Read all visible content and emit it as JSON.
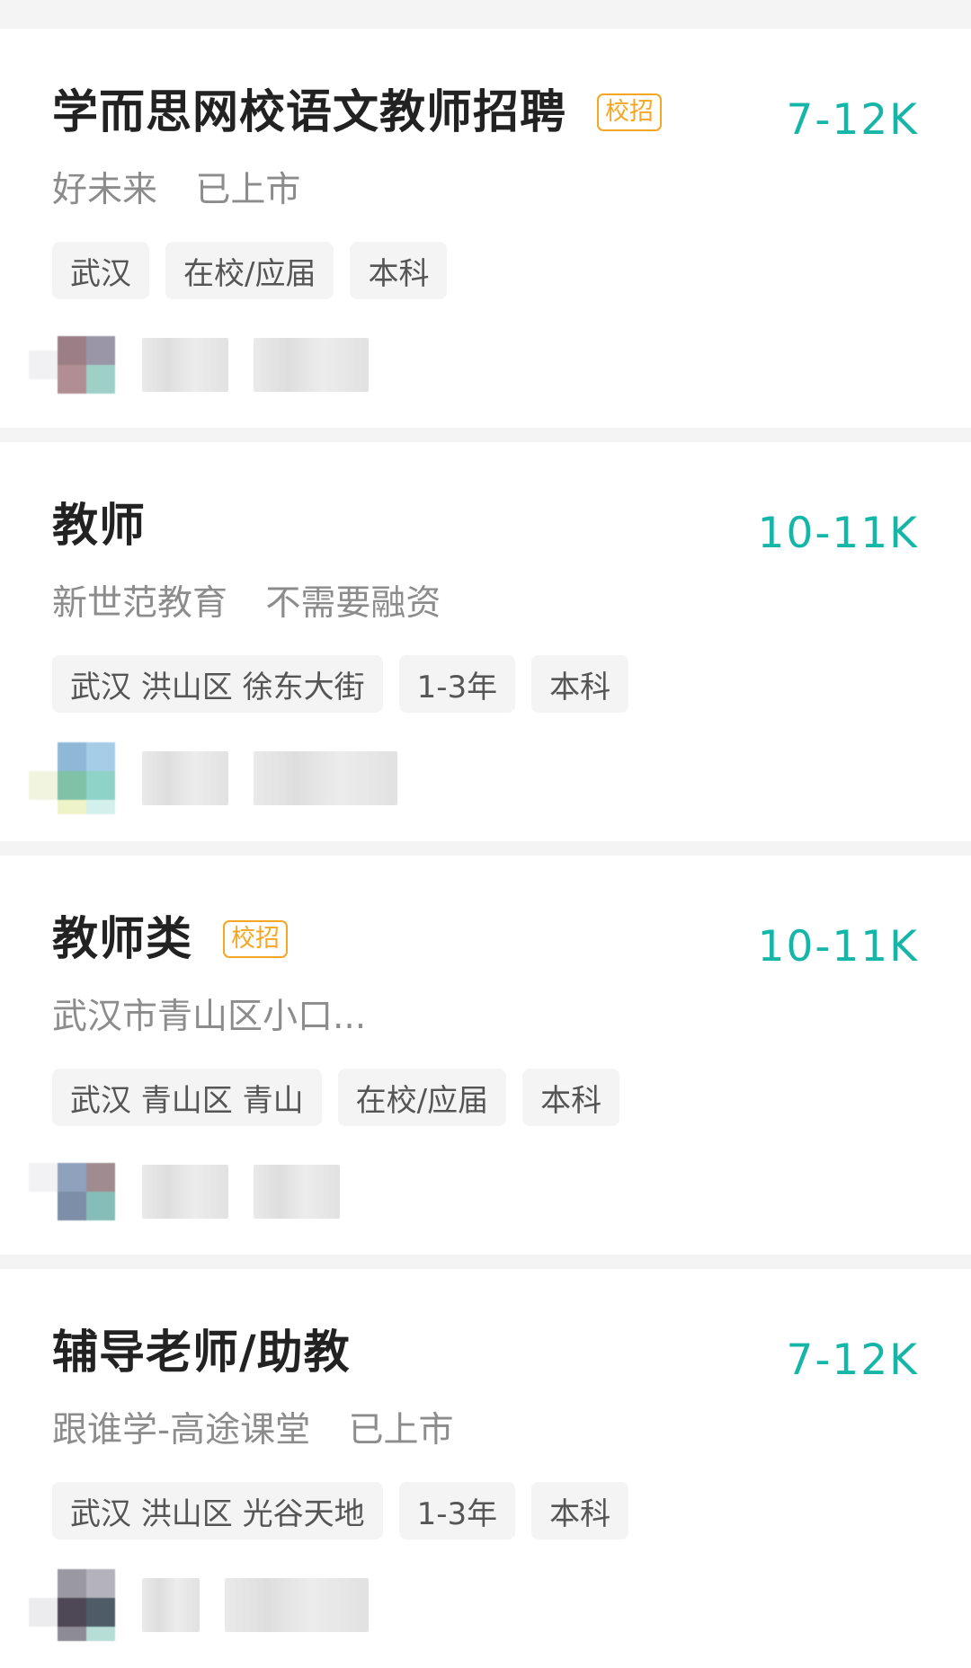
{
  "jobs": [
    {
      "title": "学而思网校语文教师招聘",
      "badge": "校招",
      "salary": "7-12K",
      "company": [
        "好未来",
        "已上市"
      ],
      "tags": [
        "武汉",
        "在校/应届",
        "本科"
      ],
      "avatar_colors": [
        "#9c7f86",
        "#9a96a8",
        "#b08e93",
        "#9fd0c8"
      ]
    },
    {
      "title": "教师",
      "badge": "",
      "salary": "10-11K",
      "company": [
        "新世范教育",
        "不需要融资"
      ],
      "tags": [
        "武汉 洪山区 徐东大街",
        "1-3年",
        "本科"
      ],
      "avatar_colors": [
        "#8fb8d6",
        "#a6cde8",
        "#7fc2a8",
        "#8fd2c8"
      ]
    },
    {
      "title": "教师类",
      "badge": "校招",
      "salary": "10-11K",
      "company": [
        "武汉市青山区小口..."
      ],
      "tags": [
        "武汉 青山区 青山",
        "在校/应届",
        "本科"
      ],
      "avatar_colors": [
        "#8fa2bd",
        "#a08c90",
        "#7c8ea8",
        "#86bdb8"
      ]
    },
    {
      "title": "辅导老师/助教",
      "badge": "",
      "salary": "7-12K",
      "company": [
        "跟谁学-高途课堂",
        "已上市"
      ],
      "tags": [
        "武汉 洪山区 光谷天地",
        "1-3年",
        "本科"
      ],
      "avatar_colors": [
        "#9a98a2",
        "#b4b2ba",
        "#4e4755",
        "#4d5c66"
      ]
    }
  ]
}
